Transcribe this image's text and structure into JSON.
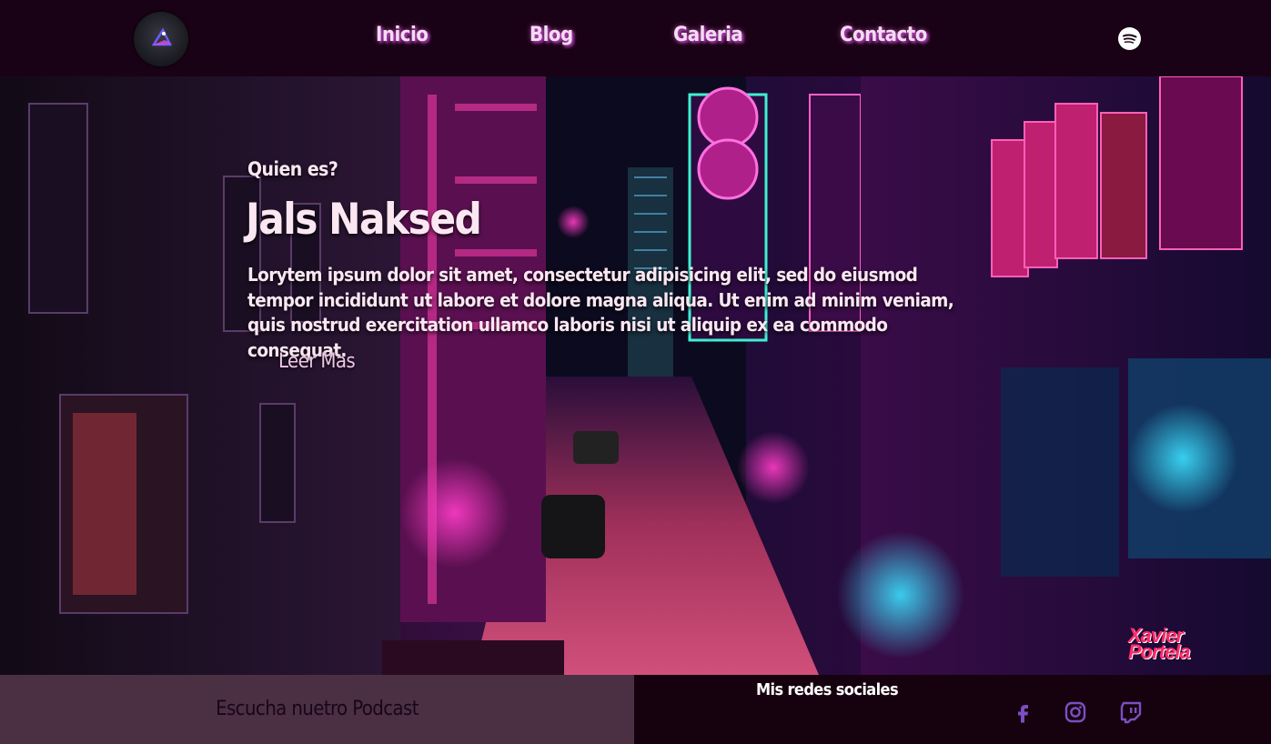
{
  "nav": {
    "items": [
      "Inicio",
      "Blog",
      "Galeria",
      "Contacto"
    ],
    "spotify_icon": "spotify-icon",
    "logo_icon": "triangle-logo-icon"
  },
  "hero": {
    "kicker": "Quien es?",
    "title": "Jals Naksed",
    "body": "Lorytem ipsum dolor sit amet, consectetur adipisicing elit, sed do eiusmod tempor incididunt ut labore et dolore magna aliqua. Ut enim ad minim veniam, quis nostrud exercitation ullamco laboris nisi ut aliquip ex ea commodo consequat.",
    "read_more": "Leer Mas",
    "watermark_line1": "Xavier",
    "watermark_line2": "Portela"
  },
  "footer": {
    "podcast_label": "Escucha nuetro Podcast",
    "social_title": "Mis redes sociales",
    "social_icons": [
      "facebook-icon",
      "instagram-icon",
      "twitch-icon"
    ]
  },
  "colors": {
    "nav_bg": "#1a0216",
    "podcast_bg": "#4b3044",
    "socials_bg": "#16020f",
    "social_icon": "#7b4fc1",
    "nav_glow": "#b43cc0"
  }
}
